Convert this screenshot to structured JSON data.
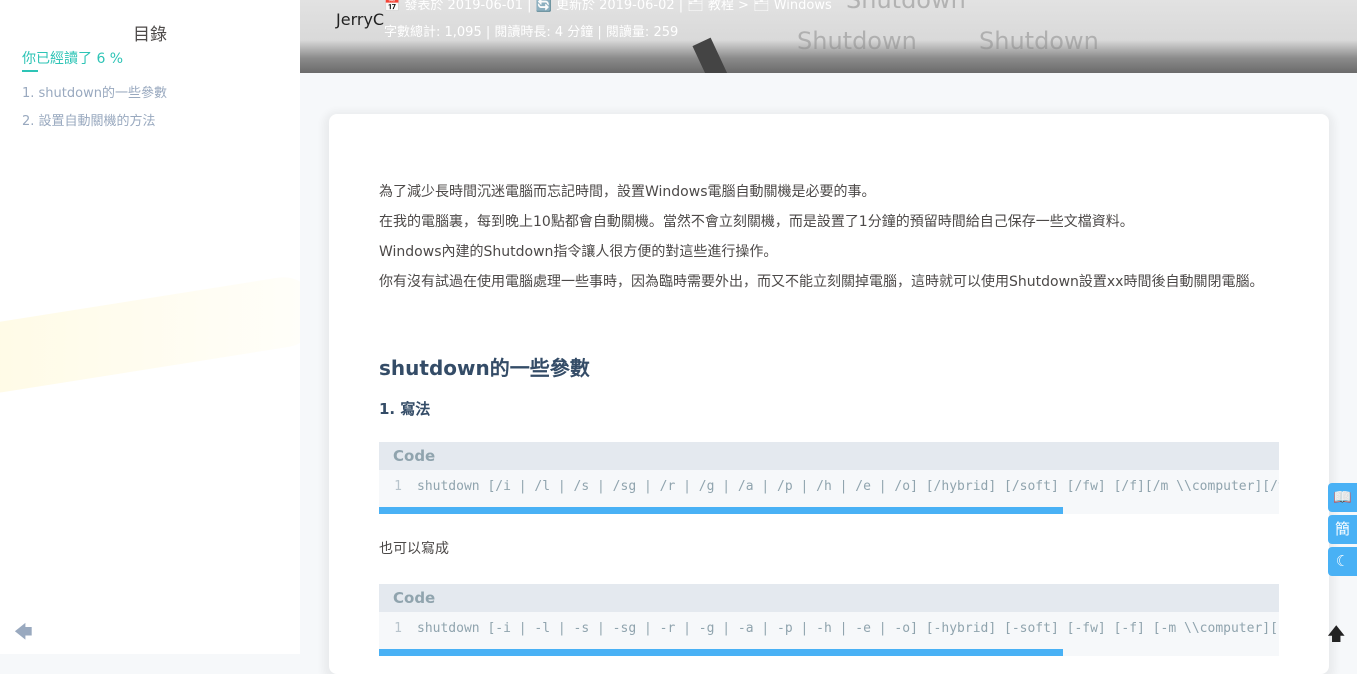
{
  "sidebar": {
    "title": "目錄",
    "progress": "你已經讀了 6 %",
    "items": [
      {
        "label": "1. shutdown的一些參數"
      },
      {
        "label": "2. 設置自動關機的方法"
      }
    ],
    "back_icon": "arrow-left-icon"
  },
  "header": {
    "author": "JerryC",
    "meta_top": "📅 發表於 2019-06-01 | 🔄 更新於 2019-06-02 | 🗂 教程 > 🗂 Windows",
    "meta": "字數總計: 1,095 | 閱讀時長: 4 分鐘 | 閱讀量: 259",
    "ghost_text": [
      "Shutdown",
      "Shutdown",
      "Shutdown"
    ]
  },
  "article": {
    "paragraphs": [
      "為了減少長時間沉迷電腦而忘記時間，設置Windows電腦自動關機是必要的事。",
      "在我的電腦裏，每到晚上10點都會自動關機。當然不會立刻關機，而是設置了1分鐘的預留時間給自己保存一些文檔資料。",
      "Windows內建的Shutdown指令讓人很方便的對這些進行操作。",
      "你有沒有試過在使用電腦處理一些事時，因為臨時需要外出，而又不能立刻關掉電腦，這時就可以使用Shutdown設置xx時間後自動關閉電腦。"
    ],
    "heading": "shutdown的一些參數",
    "subheading_num": "1.",
    "subheading_text": "寫法",
    "code1": {
      "label": "Code",
      "line_no": "1",
      "code": "shutdown [/i | /l | /s | /sg | /r | /g | /a | /p | /h | /e | /o] [/hybrid] [/soft] [/fw] [/f][/m \\\\computer][/t xxx][/d [p|u:]xx:yy [/c \"comment\"]]",
      "scroll_fraction": 0.76
    },
    "between_text": "也可以寫成",
    "code2": {
      "label": "Code",
      "line_no": "1",
      "code": "shutdown [-i | -l | -s | -sg | -r | -g | -a | -p | -h | -e | -o] [-hybrid] [-soft] [-fw] [-f] [-m \\\\computer][-t xxx][-d [p|u:]xx:yy [-c \"comment\"]]",
      "scroll_fraction": 0.76
    }
  },
  "right_buttons": [
    {
      "icon": "book-icon",
      "glyph": "📖"
    },
    {
      "icon": "simplified-chinese-icon",
      "glyph": "簡"
    },
    {
      "icon": "moon-icon",
      "glyph": "☾"
    }
  ],
  "go_top": {
    "icon": "arrow-up-icon",
    "glyph": "🡅"
  },
  "colors": {
    "accent": "#49b1f5",
    "toc_active": "#2ec4b6"
  }
}
